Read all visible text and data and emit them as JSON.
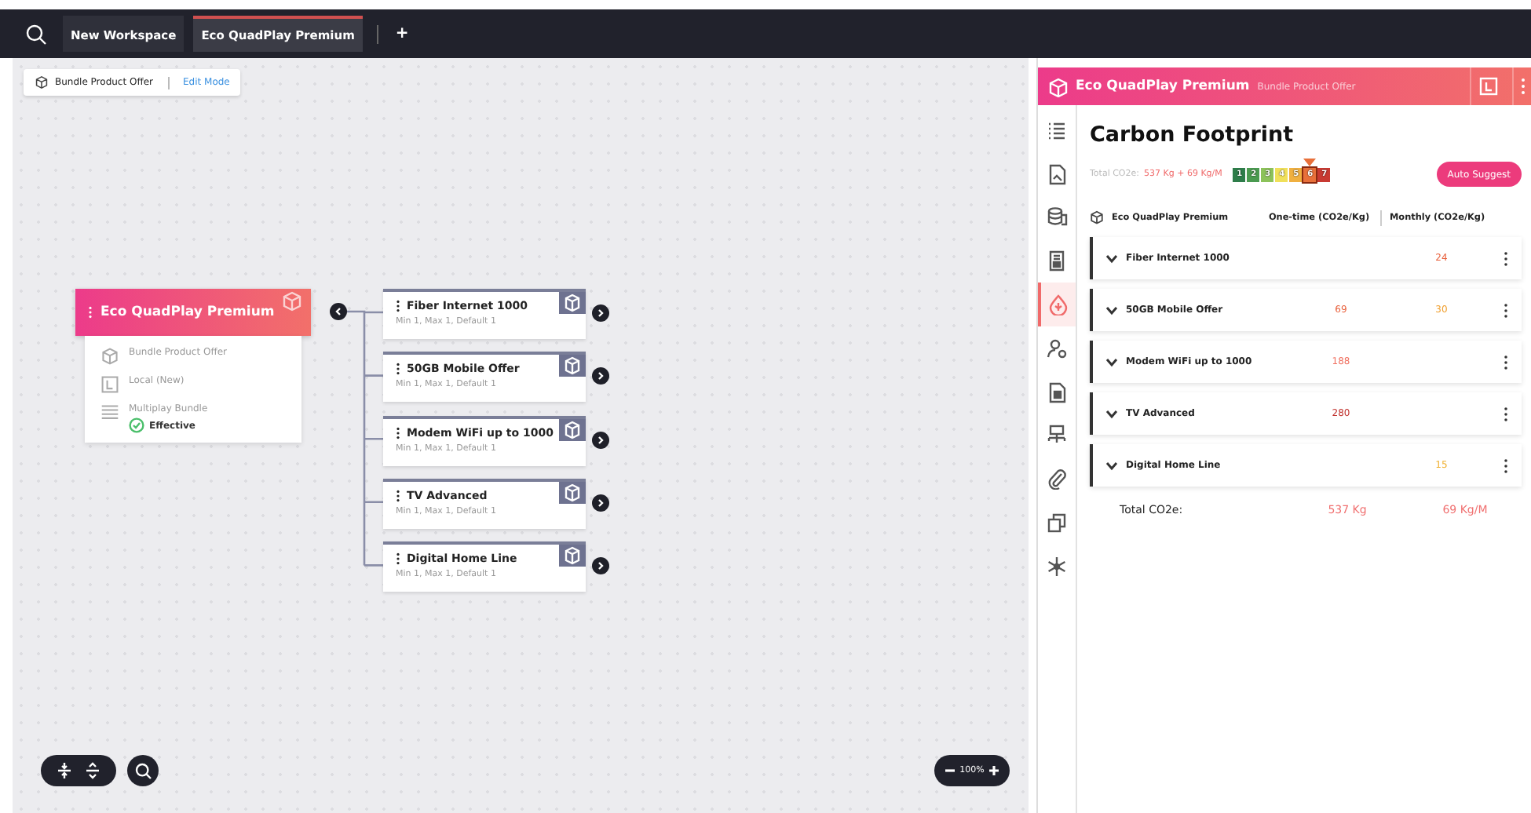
{
  "topbar": {
    "tabs": [
      {
        "label": "New Workspace",
        "selected": false
      },
      {
        "label": "Eco QuadPlay Premium",
        "selected": true
      }
    ],
    "add_label": "+"
  },
  "breadcrumb": {
    "type": "Bundle Product Offer",
    "mode": "Edit Mode"
  },
  "canvas": {
    "root": {
      "title": "Eco QuadPlay Premium",
      "details": [
        {
          "kind": "offer",
          "text": "Bundle Product Offer"
        },
        {
          "kind": "local",
          "text": "Local (New)"
        },
        {
          "kind": "bundle",
          "text": "Multiplay Bundle",
          "status": "Effective"
        }
      ]
    },
    "children": [
      {
        "title": "Fiber Internet 1000",
        "subtitle": "Min 1, Max 1, Default 1"
      },
      {
        "title": "50GB Mobile Offer",
        "subtitle": "Min 1, Max 1, Default 1"
      },
      {
        "title": "Modem WiFi up to 1000",
        "subtitle": "Min 1, Max 1, Default 1"
      },
      {
        "title": "TV Advanced",
        "subtitle": "Min 1, Max 1, Default 1"
      },
      {
        "title": "Digital Home Line",
        "subtitle": "Min 1, Max 1, Default 1"
      }
    ],
    "zoom": "100%"
  },
  "panel": {
    "title": "Eco QuadPlay Premium",
    "subtitle": "Bundle Product Offer",
    "sidebar": [
      {
        "kind": "list",
        "selected": false
      },
      {
        "kind": "document",
        "selected": false
      },
      {
        "kind": "coins",
        "selected": false
      },
      {
        "kind": "receipt",
        "selected": false
      },
      {
        "kind": "carbon",
        "selected": true
      },
      {
        "kind": "user",
        "selected": false
      },
      {
        "kind": "contract",
        "selected": false
      },
      {
        "kind": "network",
        "selected": false
      },
      {
        "kind": "attachment",
        "selected": false
      },
      {
        "kind": "copy",
        "selected": false
      },
      {
        "kind": "snowflake",
        "selected": false
      }
    ],
    "heading": "Carbon Footprint",
    "total_label": "Total CO2e:",
    "total_value": "537 Kg + 69 Kg/M",
    "scale": [
      {
        "label": "1",
        "color": "#2e7d4a",
        "selected": false
      },
      {
        "label": "2",
        "color": "#4a9a50",
        "selected": false
      },
      {
        "label": "3",
        "color": "#8cc25a",
        "selected": false
      },
      {
        "label": "4",
        "color": "#f0e05a",
        "selected": false
      },
      {
        "label": "5",
        "color": "#f0b040",
        "selected": false
      },
      {
        "label": "6",
        "color": "#e8703a",
        "selected": true
      },
      {
        "label": "7",
        "color": "#c83a32",
        "selected": false
      }
    ],
    "auto_suggest": "Auto Suggest",
    "columns": [
      "Eco QuadPlay Premium",
      "One-time (CO2e/Kg)",
      "Monthly (CO2e/Kg)"
    ],
    "rows": [
      {
        "name": "Fiber Internet 1000",
        "one_time": null,
        "monthly": {
          "value": "24",
          "color": "#e8603c"
        }
      },
      {
        "name": "50GB Mobile Offer",
        "one_time": {
          "value": "69",
          "color": "#e8603c"
        },
        "monthly": {
          "value": "30",
          "color": "#f0a030"
        }
      },
      {
        "name": "Modem WiFi up to 1000",
        "one_time": {
          "value": "188",
          "color": "#f07060"
        },
        "monthly": null
      },
      {
        "name": "TV Advanced",
        "one_time": {
          "value": "280",
          "color": "#c0302c"
        },
        "monthly": null
      },
      {
        "name": "Digital Home Line",
        "one_time": null,
        "monthly": {
          "value": "15",
          "color": "#f0b030"
        }
      }
    ],
    "total_row": {
      "label": "Total CO2e:",
      "one_time": "537 Kg",
      "monthly": "69 Kg/M"
    }
  }
}
